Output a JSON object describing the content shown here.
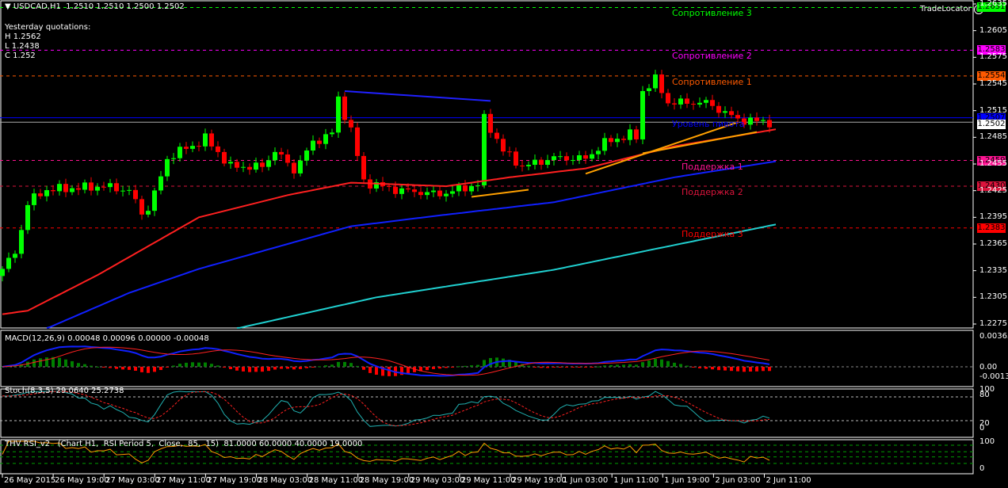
{
  "header": {
    "symbol_line": "USDCAD,H1  1.2510 1.2510 1.2500 1.2502",
    "brand": "TradeLocator",
    "brand_icon": "sad-face-icon"
  },
  "yesterday": {
    "title": "Yesterday quotations:",
    "high": "H 1.2562",
    "low": "L 1.2438",
    "close": "C 1.252"
  },
  "levels": [
    {
      "label": "Сопротивление 3",
      "price": 1.2631,
      "tag": "1.2631",
      "color": "#00ff00",
      "tag_text": "#000000"
    },
    {
      "label": "Сопротивление 2",
      "price": 1.2583,
      "tag": "1.2583",
      "color": "#ff00ff",
      "tag_text": "#000000"
    },
    {
      "label": "Сопротивление 1",
      "price": 1.2554,
      "tag": "1.2554",
      "color": "#ff5a00",
      "tag_text": "#000000"
    },
    {
      "label": "Уровень пивота",
      "price": 1.2507,
      "tag": "1.2507",
      "color": "#0000ff",
      "tag_text": "#000000"
    },
    {
      "label": "Поддержка 1",
      "price": 1.2459,
      "tag": "1.2459",
      "color": "#ff1493",
      "tag_text": "#000000"
    },
    {
      "label": "Поддержка 2",
      "price": 1.243,
      "tag": "1.2430",
      "color": "#dc143c",
      "tag_text": "#000000"
    },
    {
      "label": "Поддержка 3",
      "price": 1.2383,
      "tag": "1.2383",
      "color": "#ff0000",
      "tag_text": "#000000"
    }
  ],
  "bid_tag": "1.2502",
  "price_axis": [
    "1.2635",
    "1.2605",
    "1.2575",
    "1.2545",
    "1.2515",
    "1.2485",
    "1.2455",
    "1.2425",
    "1.2395",
    "1.2365",
    "1.2335",
    "1.2305",
    "1.2275"
  ],
  "time_axis": [
    "26 May 2015",
    "26 May 19:00",
    "27 May 03:00",
    "27 May 11:00",
    "27 May 19:00",
    "28 May 03:00",
    "28 May 11:00",
    "28 May 19:00",
    "29 May 03:00",
    "29 May 11:00",
    "29 May 19:00",
    "1 Jun 03:00",
    "1 Jun 11:00",
    "1 Jun 19:00",
    "2 Jun 03:00",
    "2 Jun 11:00"
  ],
  "macd": {
    "label": "MACD(12,26,9) 0.00048 0.00096 0.00000 -0.00048",
    "axis": [
      "0.00365",
      "0.00",
      "-0.00135"
    ],
    "range": [
      -0.00135,
      0.00365
    ]
  },
  "stoch": {
    "label": "Stoch(8,3,5) 29.0640 25.2738",
    "axis": [
      "100",
      "80",
      "20",
      "0"
    ]
  },
  "rsi": {
    "label": "THV RSI_v2   (Chart H1,  RSI Period 5,  Close,  85,  15)  81.0000 60.0000 40.0000 19.0000",
    "axis": [
      "100",
      "0"
    ]
  },
  "chart_data": {
    "type": "candlestick",
    "price_range": [
      1.227,
      1.264
    ],
    "bars": 122,
    "close_anchors": [
      [
        0,
        1.2337
      ],
      [
        2,
        1.2355
      ],
      [
        4,
        1.241
      ],
      [
        5,
        1.2417
      ],
      [
        7,
        1.2426
      ],
      [
        12,
        1.2428
      ],
      [
        16,
        1.243
      ],
      [
        20,
        1.2425
      ],
      [
        22,
        1.24
      ],
      [
        23,
        1.2405
      ],
      [
        25,
        1.244
      ],
      [
        26,
        1.2461
      ],
      [
        28,
        1.247
      ],
      [
        30,
        1.2475
      ],
      [
        32,
        1.2484
      ],
      [
        36,
        1.2452
      ],
      [
        41,
        1.2452
      ],
      [
        43,
        1.247
      ],
      [
        46,
        1.2448
      ],
      [
        49,
        1.2479
      ],
      [
        52,
        1.249
      ],
      [
        53,
        1.2528
      ],
      [
        55,
        1.2493
      ],
      [
        57,
        1.2435
      ],
      [
        62,
        1.2426
      ],
      [
        69,
        1.2421
      ],
      [
        74,
        1.243
      ],
      [
        75,
        1.2432
      ],
      [
        76,
        1.2506
      ],
      [
        77,
        1.2495
      ],
      [
        79,
        1.247
      ],
      [
        82,
        1.2452
      ],
      [
        87,
        1.2462
      ],
      [
        92,
        1.2461
      ],
      [
        95,
        1.2479
      ],
      [
        99,
        1.2488
      ],
      [
        100,
        1.2485
      ],
      [
        101,
        1.2537
      ],
      [
        103,
        1.255
      ],
      [
        105,
        1.2524
      ],
      [
        111,
        1.2524
      ],
      [
        116,
        1.2505
      ],
      [
        121,
        1.2502
      ]
    ],
    "moving_averages": [
      {
        "name": "ma-fast",
        "color": "#ff2020",
        "anchors": [
          [
            0,
            1.2286
          ],
          [
            4,
            1.229
          ],
          [
            15,
            1.233
          ],
          [
            31,
            1.2395
          ],
          [
            45,
            1.242
          ],
          [
            55,
            1.2434
          ],
          [
            70,
            1.243
          ],
          [
            80,
            1.244
          ],
          [
            92,
            1.245
          ],
          [
            106,
            1.2475
          ],
          [
            122,
            1.2494
          ]
        ]
      },
      {
        "name": "ma-medium",
        "color": "#1020ff",
        "anchors": [
          [
            7,
            1.227
          ],
          [
            20,
            1.231
          ],
          [
            31,
            1.2337
          ],
          [
            55,
            1.2385
          ],
          [
            70,
            1.2398
          ],
          [
            87,
            1.2412
          ],
          [
            106,
            1.244
          ],
          [
            122,
            1.2458
          ]
        ]
      },
      {
        "name": "ma-slow",
        "color": "#20d0d0",
        "anchors": [
          [
            37,
            1.227
          ],
          [
            59,
            1.2305
          ],
          [
            87,
            1.2336
          ],
          [
            102,
            1.2358
          ],
          [
            122,
            1.2387
          ]
        ]
      }
    ],
    "trendlines": [
      {
        "color": "#2020ff",
        "from": [
          54,
          1.2537
        ],
        "to": [
          77,
          1.2526
        ]
      },
      {
        "color": "#ffa000",
        "from": [
          74,
          1.2418
        ],
        "to": [
          83,
          1.2426
        ]
      },
      {
        "color": "#ffa000",
        "from": [
          92,
          1.2444
        ],
        "to": [
          116,
          1.2502
        ]
      },
      {
        "color": "#ffa000",
        "from": [
          101,
          1.2467
        ],
        "to": [
          119,
          1.2491
        ]
      }
    ]
  }
}
